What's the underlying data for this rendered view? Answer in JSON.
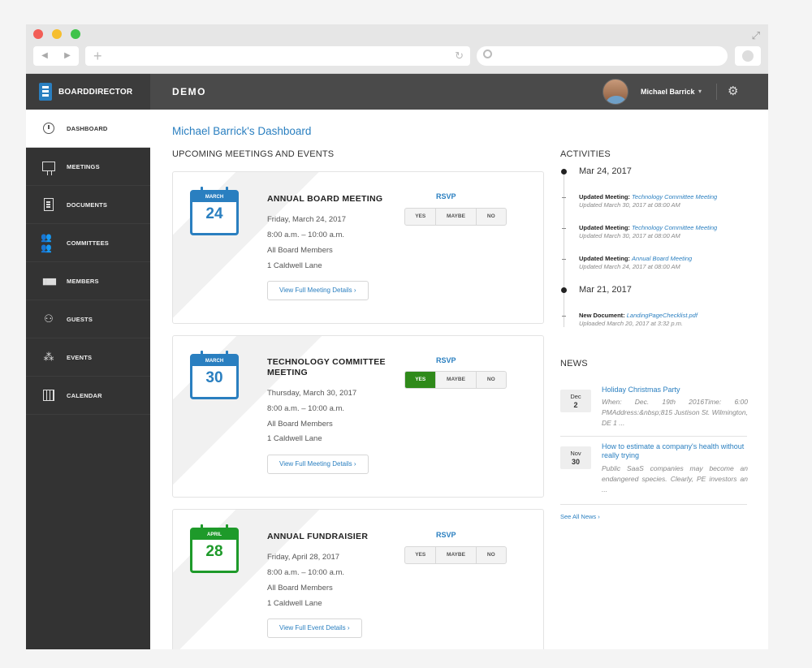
{
  "browser": {
    "back_icon": "back-arrow-icon",
    "forward_icon": "forward-arrow-icon"
  },
  "app": {
    "brand": "BOARDDIRECTOR",
    "org": "DEMO",
    "user": "Michael Barrick"
  },
  "sidebar": {
    "items": [
      {
        "label": "DASHBOARD",
        "icon": "clock-icon",
        "active": true
      },
      {
        "label": "MEETINGS",
        "icon": "presentation-board-icon"
      },
      {
        "label": "DOCUMENTS",
        "icon": "document-icon"
      },
      {
        "label": "COMMITTEES",
        "icon": "people-group-icon"
      },
      {
        "label": "MEMBERS",
        "icon": "members-icon"
      },
      {
        "label": "GUESTS",
        "icon": "guests-icon"
      },
      {
        "label": "EVENTS",
        "icon": "events-icon"
      },
      {
        "label": "CALENDAR",
        "icon": "calendar-icon"
      }
    ]
  },
  "main": {
    "title": "Michael Barrick's Dashboard",
    "upcoming_title": "UPCOMING MEETINGS AND EVENTS",
    "rsvp_label": "RSVP",
    "rsvp_options": {
      "yes": "YES",
      "maybe": "MAYBE",
      "no": "NO"
    },
    "events": [
      {
        "month": "MARCH",
        "day": "24",
        "color": "#2a7fc0",
        "title": "ANNUAL BOARD MEETING",
        "date": "Friday, March 24, 2017",
        "time": "8:00 a.m. – 10:00 a.m.",
        "attendees": "All Board Members",
        "location": "1 Caldwell Lane",
        "button": "View Full Meeting Details ›",
        "rsvp_selected": ""
      },
      {
        "month": "MARCH",
        "day": "30",
        "color": "#2a7fc0",
        "title": "TECHNOLOGY COMMITTEE MEETING",
        "date": "Thursday, March 30, 2017",
        "time": "8:00 a.m. – 10:00 a.m.",
        "attendees": "All Board Members",
        "location": "1 Caldwell Lane",
        "button": "View Full Meeting Details ›",
        "rsvp_selected": "yes"
      },
      {
        "month": "APRIL",
        "day": "28",
        "color": "#1e9a2a",
        "title": "ANNUAL FUNDRAISIER",
        "date": "Friday, April 28, 2017",
        "time": "8:00 a.m. – 10:00 a.m.",
        "attendees": "All Board Members",
        "location": "1 Caldwell Lane",
        "button": "View Full Event Details ›",
        "rsvp_selected": ""
      }
    ]
  },
  "activities": {
    "title": "ACTIVITIES",
    "groups": [
      {
        "date": "Mar 24, 2017",
        "items": [
          {
            "action": "Updated Meeting:",
            "link": "Technology Committee Meeting",
            "sub": "Updated March 30, 2017 at 08:00 AM"
          },
          {
            "action": "Updated Meeting:",
            "link": "Technology Committee Meeting",
            "sub": "Updated March 30, 2017 at 08:00 AM"
          },
          {
            "action": "Updated Meeting:",
            "link": "Annual Board Meeting",
            "sub": "Updated March 24, 2017 at 08:00 AM"
          }
        ]
      },
      {
        "date": "Mar 21, 2017",
        "items": [
          {
            "action": "New Document:",
            "link": "LandingPageChecklist.pdf",
            "sub": "Uploaded March 20, 2017 at 3:32 p.m."
          }
        ]
      }
    ]
  },
  "news": {
    "title": "NEWS",
    "items": [
      {
        "month": "Dec",
        "day": "2",
        "title": "Holiday Christmas Party",
        "body": "When: Dec. 19th 2016Time: 6:00 PMAddress:&nbsp;815 Justison St. Wilmington, DE 1 ..."
      },
      {
        "month": "Nov",
        "day": "30",
        "title": "How to estimate a company's health without really trying",
        "body": "Public SaaS companies may become an endangered species. Clearly, PE investors an ..."
      }
    ],
    "see_all": "See All News ›"
  }
}
